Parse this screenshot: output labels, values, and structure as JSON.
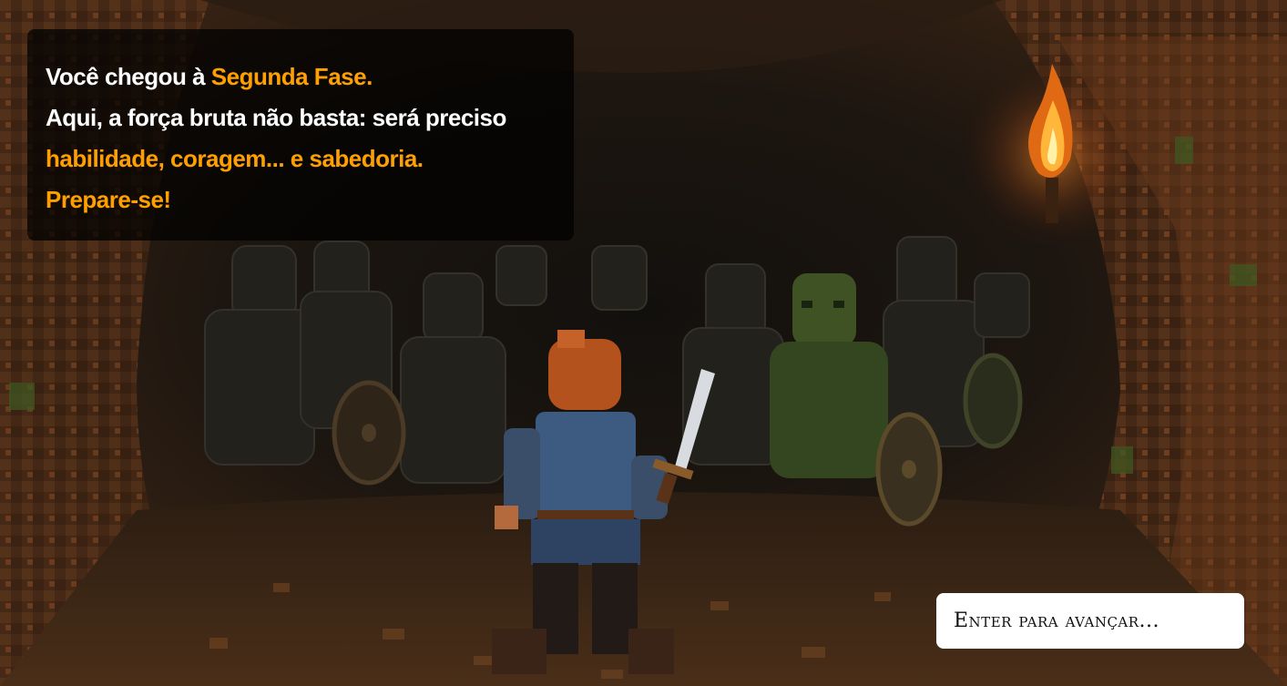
{
  "dialog": {
    "line1_prefix": "Você chegou à ",
    "line1_highlight": "Segunda Fase.",
    "line2": "Aqui, a força bruta não basta: será preciso",
    "line3": "habilidade, coragem... e sabedoria.",
    "line4": "Prepare-se!"
  },
  "advance_prompt": {
    "label": "Enter para avançar..."
  },
  "colors": {
    "highlight": "#ffa000",
    "text": "#ffffff",
    "dialog_bg": "rgba(0,0,0,0.72)"
  },
  "scene": {
    "setting": "cave",
    "icons": [
      "torch-icon",
      "hero-sprite",
      "sword-icon",
      "goblin-sprite",
      "shield-icon"
    ]
  }
}
